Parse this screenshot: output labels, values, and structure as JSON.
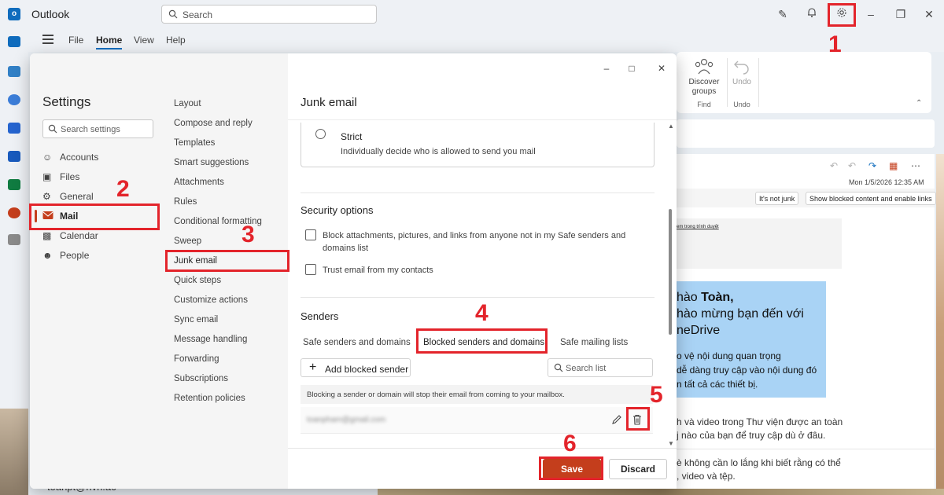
{
  "app": {
    "title": "Outlook",
    "search_placeholder": "Search",
    "account": "toanpt@hvn.ac"
  },
  "ribbon": {
    "tabs": [
      "File",
      "Home",
      "View",
      "Help"
    ],
    "active_tab": "Home",
    "groups": [
      {
        "label_line1": "Discover",
        "label_line2": "groups",
        "group": "Find"
      },
      {
        "label_line1": "Undo",
        "label_line2": "",
        "group": "Undo"
      }
    ]
  },
  "reading_pane": {
    "date": "Mon 1/5/2026 12:35 AM",
    "junk_buttons": [
      "It's not junk",
      "Show blocked content and enable links"
    ],
    "link_text": "em trong trình duyệt",
    "banner_line1": "hào Toàn,",
    "banner_line1_bold": "Toàn,",
    "banner_line2": "hào mừng bạn đến với",
    "banner_line3": "neDrive",
    "banner_body": [
      "o vệ nội dung quan trọng",
      "dễ dàng truy cập vào nội dung đó",
      "n tất cả các thiết bị."
    ],
    "body_lines": [
      "h và video trong Thư viện được an toàn",
      "j nào của bạn để truy cập dù ở đâu.",
      "è không cần lo lắng khi biết rằng có thể",
      ", video và tệp."
    ]
  },
  "settings": {
    "title": "Settings",
    "search_placeholder": "Search settings",
    "nav": [
      {
        "label": "Accounts",
        "icon": "person-icon"
      },
      {
        "label": "Files",
        "icon": "file-icon"
      },
      {
        "label": "General",
        "icon": "gear-icon"
      },
      {
        "label": "Mail",
        "icon": "mail-icon",
        "active": true
      },
      {
        "label": "Calendar",
        "icon": "calendar-icon"
      },
      {
        "label": "People",
        "icon": "people-icon"
      }
    ],
    "mail_nav": [
      "Layout",
      "Compose and reply",
      "Templates",
      "Smart suggestions",
      "Attachments",
      "Rules",
      "Conditional formatting",
      "Sweep",
      "Junk email",
      "Quick steps",
      "Customize actions",
      "Sync email",
      "Message handling",
      "Forwarding",
      "Subscriptions",
      "Retention policies"
    ],
    "mail_nav_active": "Junk email"
  },
  "junk": {
    "title": "Junk email",
    "strict_label": "Strict",
    "strict_desc": "Individually decide who is allowed to send you mail",
    "security_title": "Security options",
    "security_opt1_line1": "Block attachments, pictures, and links from anyone not in my Safe senders and",
    "security_opt1_line2": "domains list",
    "security_opt2": "Trust email from my contacts",
    "senders_title": "Senders",
    "tabs": [
      "Safe senders and domains",
      "Blocked senders and domains",
      "Safe mailing lists"
    ],
    "active_tab": "Blocked senders and domains",
    "add_button": "Add blocked sender",
    "list_search_placeholder": "Search list",
    "info": "Blocking a sender or domain will stop their email from coming to your mailbox.",
    "blocked_email": "toanpham@gmail.com",
    "save": "Save",
    "discard": "Discard"
  },
  "annotations": {
    "steps": [
      "1",
      "2",
      "3",
      "4",
      "5",
      "6"
    ],
    "color": "#e3242b"
  },
  "colors": {
    "accent": "#0f6cbd",
    "save": "#c43e1c",
    "annotation": "#e3242b"
  }
}
